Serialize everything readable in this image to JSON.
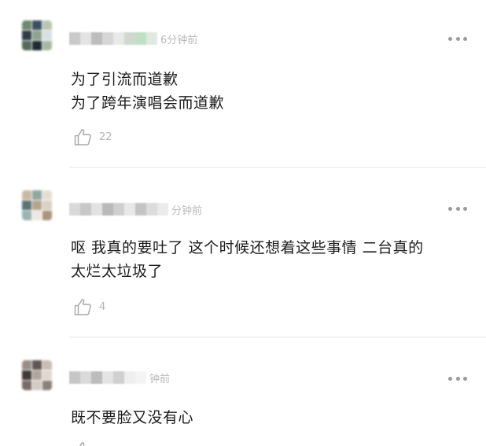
{
  "comments": [
    {
      "time": "6分钟前",
      "lines": [
        "为了引流而道歉",
        "为了跨年演唱会而道歉"
      ],
      "likes": "22",
      "avatar_colors": [
        "#6f8a6a",
        "#3b4f63",
        "#b9c7b0",
        "#2f3b47",
        "#8ea38a",
        "#d8dfe3",
        "#556b5a",
        "#1f2a33",
        "#a7b9a2"
      ],
      "name_colors": [
        "#c9c9c9",
        "#e3e3e3",
        "#bdbdbd",
        "#d6d6d6",
        "#e9e9e9",
        "#cfd9cf",
        "#bfe0c5",
        "#dfe9df"
      ]
    },
    {
      "time": "分钟前",
      "lines": [
        "呕 我真的要吐了 这个时候还想着这些事情 二台真的",
        "太烂太垃圾了"
      ],
      "likes": "4",
      "avatar_colors": [
        "#c9b9a2",
        "#8fa7a3",
        "#e6ddd0",
        "#5a7474",
        "#b7a48a",
        "#d9d2c6",
        "#9cb3b0",
        "#efe8dd",
        "#a8947a"
      ],
      "name_colors": [
        "#d9d9d9",
        "#c8c8c8",
        "#e2e2e2",
        "#b9b9b9",
        "#cfcfcf",
        "#e8e8e8",
        "#c4c4c4",
        "#dcdcdc",
        "#ebebeb"
      ]
    },
    {
      "time": "钟前",
      "lines": [
        "既不要脸又没有心"
      ],
      "avatar_colors": [
        "#9a8f86",
        "#5e5650",
        "#c7bdb4",
        "#3f3a36",
        "#b0a59b",
        "#e0d8d0",
        "#776d66",
        "#d4cbc2",
        "#8a8078"
      ],
      "name_colors": [
        "#c6c6c6",
        "#dadada",
        "#bcbcbc",
        "#e4e4e4",
        "#d0d0d0",
        "#efefef",
        "#f4f4f4"
      ]
    }
  ]
}
